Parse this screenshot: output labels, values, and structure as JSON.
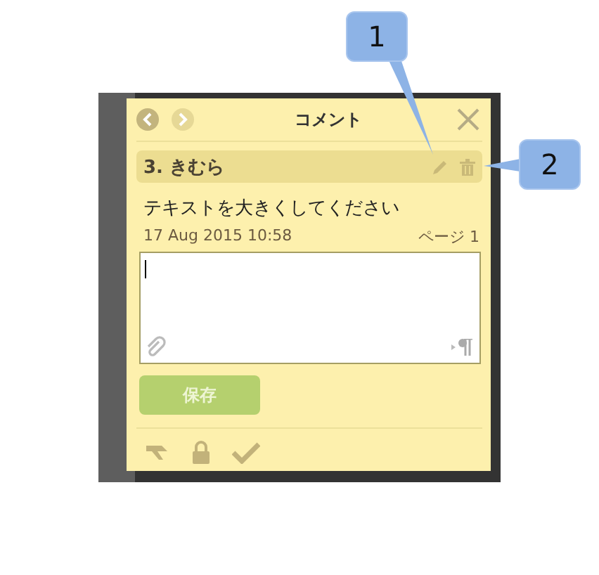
{
  "header": {
    "title": "コメント",
    "back_disabled": false,
    "forward_disabled": true
  },
  "comment": {
    "author": "3. きむら",
    "text": "テキストを大きくしてください",
    "date": "17 Aug 2015 10:58",
    "page": "ページ 1"
  },
  "save_button": {
    "label": "保存",
    "disabled": true
  },
  "callouts": [
    {
      "label": "1"
    },
    {
      "label": "2"
    }
  ]
}
